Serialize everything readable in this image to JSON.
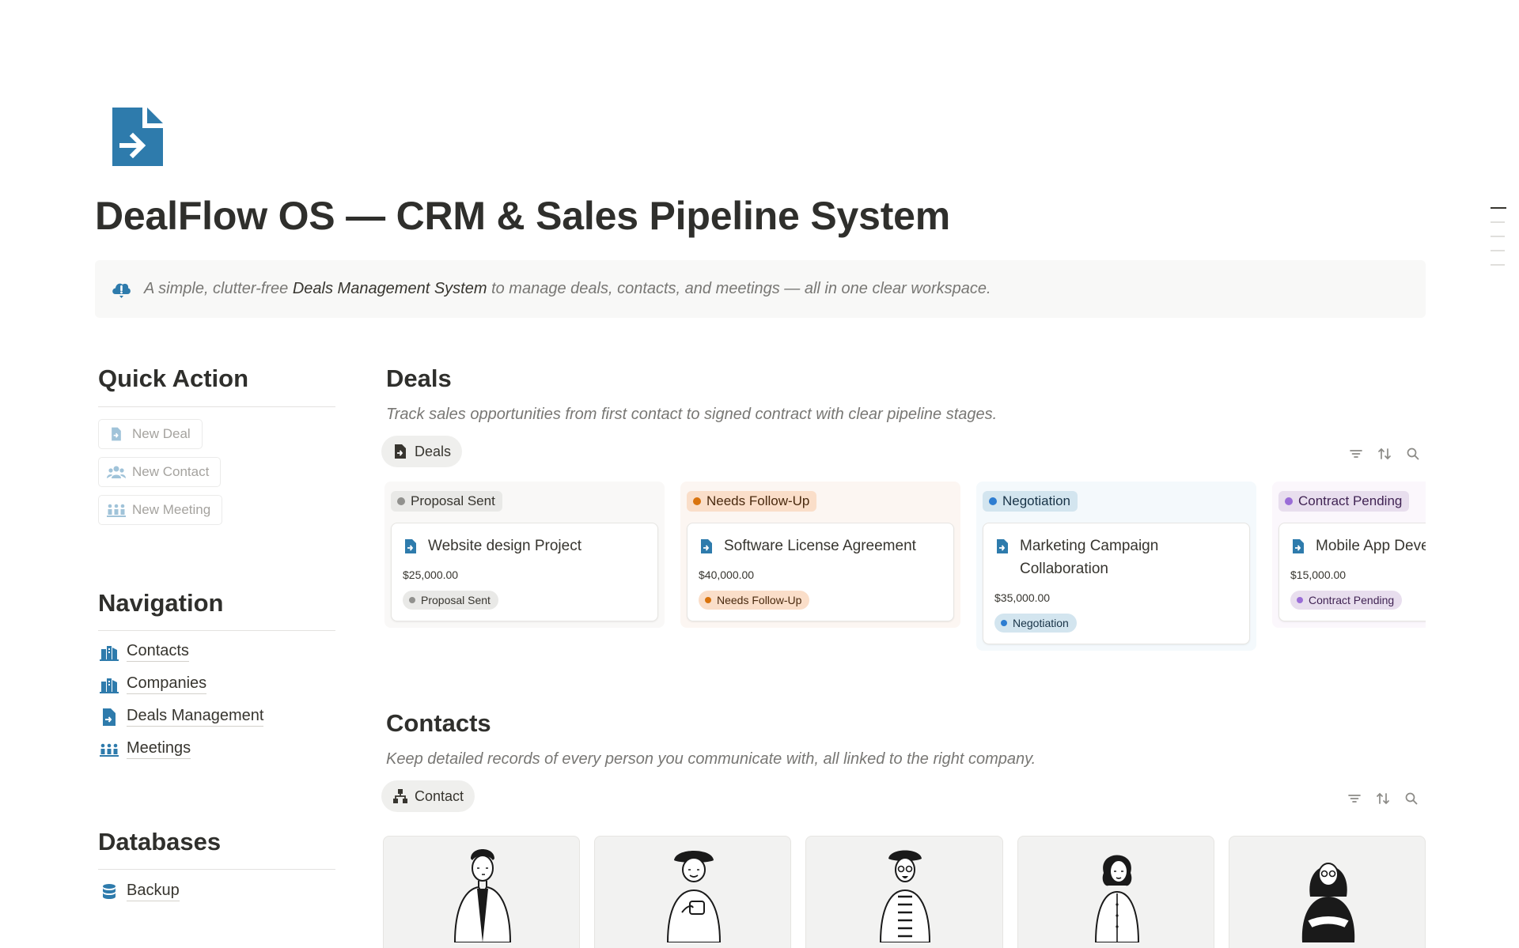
{
  "page": {
    "title": "DealFlow OS — CRM & Sales Pipeline System",
    "icon": "document-arrow-icon",
    "accent_color": "#2e7bac"
  },
  "callout": {
    "icon": "cloud-alert-icon",
    "text_before": "A simple, clutter-free ",
    "text_highlight": "Deals Management System",
    "text_after": " to manage deals, contacts, and meetings — all in one clear workspace."
  },
  "quick_action": {
    "heading": "Quick Action",
    "buttons": [
      {
        "label": "New Deal",
        "icon": "document-icon"
      },
      {
        "label": "New Contact",
        "icon": "people-icon"
      },
      {
        "label": "New Meeting",
        "icon": "meeting-icon"
      }
    ]
  },
  "navigation": {
    "heading": "Navigation",
    "items": [
      {
        "label": "Contacts",
        "icon": "buildings-icon"
      },
      {
        "label": "Companies",
        "icon": "buildings-icon"
      },
      {
        "label": "Deals Management",
        "icon": "document-icon"
      },
      {
        "label": "Meetings",
        "icon": "meeting-icon"
      }
    ]
  },
  "databases": {
    "heading": "Databases",
    "items": [
      {
        "label": "Backup",
        "icon": "database-icon"
      }
    ]
  },
  "deals": {
    "heading": "Deals",
    "description": "Track sales opportunities from first contact to signed contract with clear pipeline stages.",
    "view_tab": "Deals",
    "columns": [
      {
        "status": "Proposal Sent",
        "bg": "#f9f8f7",
        "pill_bg": "#e9e9e7",
        "pill_text": "#37352f",
        "dot": "#91918e",
        "card": {
          "title": "Website design Project",
          "value": "$25,000.00",
          "tag": "Proposal Sent"
        }
      },
      {
        "status": "Needs Follow-Up",
        "bg": "#fcf6f2",
        "pill_bg": "#fadec9",
        "pill_text": "#49290e",
        "dot": "#d9730d",
        "card": {
          "title": "Software License Agreement",
          "value": "$40,000.00",
          "tag": "Needs Follow-Up"
        }
      },
      {
        "status": "Negotiation",
        "bg": "#f4f9fc",
        "pill_bg": "#d3e5ef",
        "pill_text": "#183347",
        "dot": "#2e7dd1",
        "card": {
          "title": "Marketing Campaign Collaboration",
          "value": "$35,000.00",
          "tag": "Negotiation"
        }
      },
      {
        "status": "Contract Pending",
        "bg": "#fbf7fc",
        "pill_bg": "#e8deee",
        "pill_text": "#412454",
        "dot": "#9a6dd7",
        "card": {
          "title": "Mobile App Devel",
          "value": "$15,000.00",
          "tag": "Contract Pending"
        }
      }
    ]
  },
  "contacts": {
    "heading": "Contacts",
    "description": "Keep detailed records of every person you communicate with, all linked to the right company.",
    "view_tab": "Contact",
    "cards": [
      {
        "avatar": "person-illustration-icon"
      },
      {
        "avatar": "person-illustration-icon"
      },
      {
        "avatar": "person-illustration-icon"
      },
      {
        "avatar": "person-illustration-icon"
      },
      {
        "avatar": "person-illustration-icon"
      }
    ]
  }
}
